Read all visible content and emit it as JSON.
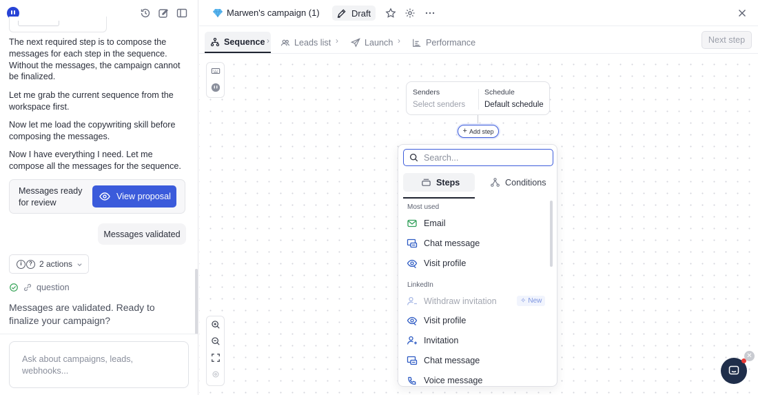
{
  "chat": {
    "messages": [
      "The next required step is to compose the messages for each step in the sequence. Without the messages, the campaign cannot be finalized.",
      "Let me grab the current sequence from the workspace first.",
      "Now let me load the copywriting skill before composing the messages.",
      "Now I have everything I need. Let me compose all the messages for the sequence."
    ],
    "ready_label": "Messages ready for review",
    "view_proposal_label": "View proposal",
    "validated_bubble": "Messages validated",
    "actions_label": "2 actions",
    "question_label": "question",
    "final_message": "Messages are validated. Ready to finalize your campaign?",
    "composer_placeholder": "Ask about campaigns, leads, webhooks..."
  },
  "header": {
    "campaign_title": "Marwen's campaign (1)",
    "status": "Draft"
  },
  "tabs": {
    "sequence": "Sequence",
    "leads": "Leads list",
    "launch": "Launch",
    "performance": "Performance",
    "next_step": "Next step"
  },
  "canvas": {
    "senders_title": "Senders",
    "senders_value": "Select senders",
    "schedule_title": "Schedule",
    "schedule_value": "Default schedule",
    "add_step": "Add step"
  },
  "step_picker": {
    "search_placeholder": "Search...",
    "tab_steps": "Steps",
    "tab_conditions": "Conditions",
    "most_used_title": "Most used",
    "most_used": [
      "Email",
      "Chat message",
      "Visit profile"
    ],
    "linkedin_title": "LinkedIn",
    "linkedin": [
      "Withdraw invitation",
      "Visit profile",
      "Invitation",
      "Chat message",
      "Voice message"
    ],
    "new_badge": "New"
  },
  "colors": {
    "accent": "#3b5bdb",
    "linkedin_icon": "#2b59c3",
    "email_icon": "#2e9e57"
  }
}
